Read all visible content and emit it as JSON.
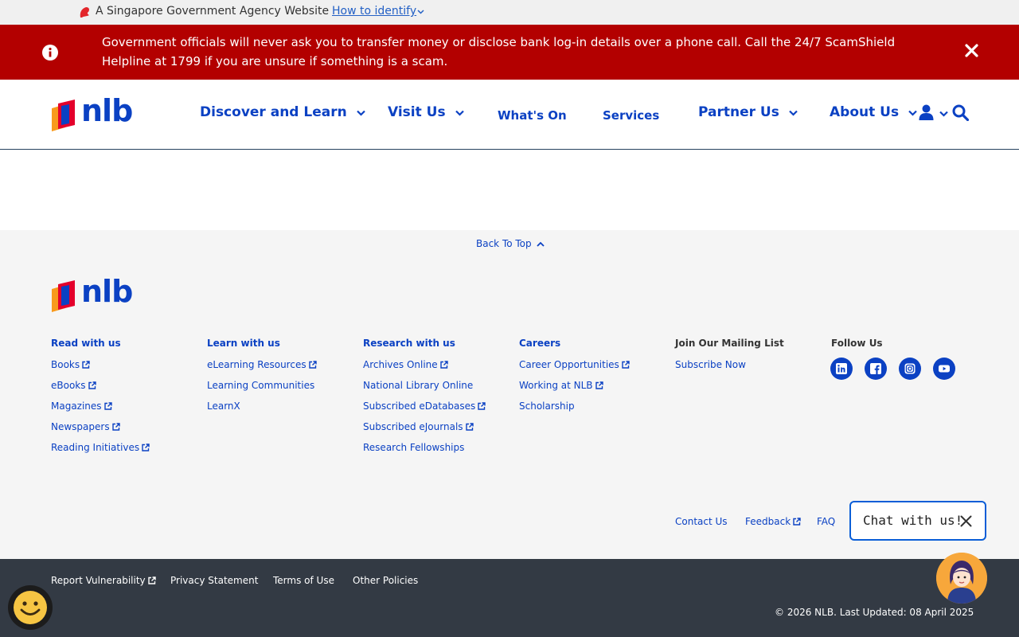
{
  "gov_banner": {
    "text": "A Singapore Government Agency Website",
    "link": "How to identify"
  },
  "alert": {
    "message": "Government officials will never ask you to transfer money or disclose bank log-in details over a phone call. Call the 24/7 ScamShield Helpline at 1799 if you are unsure if something is a scam."
  },
  "logo_text": "nlb",
  "nav": {
    "discover": "Discover and Learn",
    "visit": "Visit Us",
    "whats_on": "What's On",
    "services": "Services",
    "partner": "Partner Us",
    "about": "About Us"
  },
  "back_to_top": "Back To Top",
  "footer": {
    "columns": [
      {
        "heading": "Read with us",
        "links": [
          "Books",
          "eBooks",
          "Magazines",
          "Newspapers",
          "Reading Initiatives"
        ]
      },
      {
        "heading": "Learn with us",
        "links": [
          "eLearning Resources",
          "Learning Communities",
          "LearnX"
        ]
      },
      {
        "heading": "Research with us",
        "links": [
          "Archives Online",
          "National Library Online",
          "Subscribed eDatabases",
          "Subscribed eJournals",
          "Research Fellowships"
        ]
      },
      {
        "heading": "Careers",
        "links": [
          "Career Opportunities",
          "Working at NLB",
          "Scholarship"
        ]
      },
      {
        "heading": "Join Our Mailing List",
        "links": [
          "Subscribe Now"
        ]
      },
      {
        "heading": "Follow Us"
      }
    ],
    "social": [
      "linkedin-icon",
      "facebook-icon",
      "instagram-icon",
      "youtube-icon"
    ],
    "contact": "Contact Us",
    "feedback": "Feedback",
    "faq": "FAQ"
  },
  "chat": {
    "label": "Chat with us!"
  },
  "bottom": {
    "report": "Report Vulnerability",
    "privacy": "Privacy Statement",
    "terms": "Terms of Use",
    "other": "Other Policies",
    "copyright": "© 2026 NLB. Last Updated: 08 April 2025"
  },
  "colors": {
    "brand_blue": "#0b41c3",
    "alert_red": "#b30000",
    "footer_dark": "#333a44",
    "logo_orange": "#f89a1c",
    "logo_red": "#e4002b"
  }
}
